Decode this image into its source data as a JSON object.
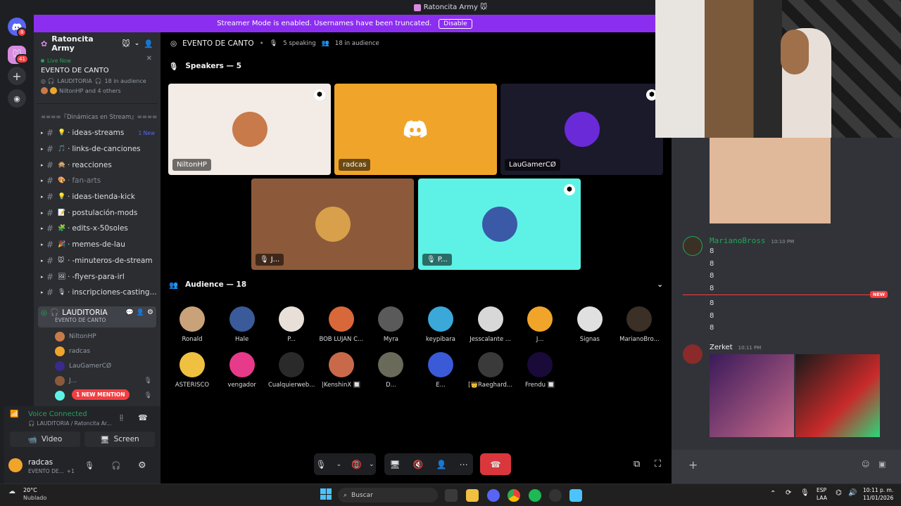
{
  "window": {
    "title": "Ratoncita Army"
  },
  "banner": {
    "text": "Streamer Mode is enabled. Usernames have been truncated.",
    "button": "Disable"
  },
  "rail": {
    "badge_top": "8",
    "badge_server": "41"
  },
  "server": {
    "name": "Ratoncita Army"
  },
  "live": {
    "status": "Live Now",
    "event": "EVENTO DE CANTO",
    "channel": "LAUDITORIA",
    "audience": "18 in audience",
    "others": "NiltonHP and 4 others"
  },
  "category": "====『Dinámicas en Stream』====",
  "channels": [
    {
      "name": "ideas-streams",
      "emoji": "💡",
      "badge": "1 New"
    },
    {
      "name": "links-de-canciones",
      "emoji": "🎵"
    },
    {
      "name": "reacciones",
      "emoji": "🙊"
    },
    {
      "name": "fan-arts",
      "emoji": "🎨"
    },
    {
      "name": "ideas-tienda-kick",
      "emoji": "💡"
    },
    {
      "name": "postulación-mods",
      "emoji": "📝"
    },
    {
      "name": "edits-x-50soles",
      "emoji": "🧩"
    },
    {
      "name": "memes-de-lau",
      "emoji": "🎉"
    },
    {
      "name": "-minuteros-de-stream",
      "emoji": "🐭"
    },
    {
      "name": "-flyers-para-irl",
      "emoji": "🖼"
    },
    {
      "name": "inscripciones-casting...",
      "emoji": "🎙"
    }
  ],
  "voice_channel": {
    "name": "LAUDITORIA",
    "sub": "EVENTO DE CANTO",
    "users": [
      "NiltonHP",
      "radcas",
      "LauGamerCØ",
      "J...",
      ""
    ]
  },
  "mention_pill": "1 NEW MENTION",
  "voice_panel": {
    "status": "Voice Connected",
    "location": "LAUDITORIA / Ratoncita Ar...",
    "video": "Video",
    "screen": "Screen"
  },
  "user": {
    "name": "radcas",
    "status": "EVENTO DE...",
    "extra": "+1"
  },
  "stage": {
    "title": "EVENTO DE CANTO",
    "speaking": "5 speaking",
    "audience": "18 in audience",
    "speakers_header": "Speakers — 5",
    "audience_header": "Audience — 18"
  },
  "speakers": [
    {
      "name": "NiltonHP",
      "bg": "#f2ebe6"
    },
    {
      "name": "radcas",
      "bg": "#f0a52a"
    },
    {
      "name": "LauGamerCØ",
      "bg": "#1b1a2a"
    },
    {
      "name": "J...",
      "bg": "#8c5a3a"
    },
    {
      "name": "P...",
      "bg": "#5ef2e6"
    }
  ],
  "audience": [
    {
      "name": "Ronald",
      "color": "#c9a27a"
    },
    {
      "name": "Hale",
      "color": "#3a5a9a"
    },
    {
      "name": "P...",
      "color": "#e8e0d8"
    },
    {
      "name": "BOB LUJAN C...",
      "color": "#d8683a"
    },
    {
      "name": "Myra",
      "color": "#5a5a5a"
    },
    {
      "name": "keypibara",
      "color": "#3aa8d8"
    },
    {
      "name": "Jesscalante ...",
      "color": "#d8d8d8"
    },
    {
      "name": "J...",
      "color": "#f0a52a"
    },
    {
      "name": "Signas",
      "color": "#e0e0e0"
    },
    {
      "name": "MarianoBro...",
      "color": "#3a3026"
    },
    {
      "name": "ASTERISCO",
      "color": "#f0c040"
    },
    {
      "name": "vengador",
      "color": "#e83a8a"
    },
    {
      "name": "Cualquierweb...",
      "color": "#2a2a2a"
    },
    {
      "name": "|KenshinX 🔲",
      "color": "#c86a4a"
    },
    {
      "name": "D...",
      "color": "#6a6a5a"
    },
    {
      "name": "E...",
      "color": "#3a5ad8"
    },
    {
      "name": "[👑Raeghard...",
      "color": "#3a3a3a"
    },
    {
      "name": "Frendu 🔲",
      "color": "#1a0a3a"
    }
  ],
  "chat": {
    "messages": [
      {
        "author": "MarianoBross",
        "time": "10:10 PM",
        "lines": [
          "8",
          "8",
          "8",
          "8"
        ]
      },
      {
        "lines": [
          "8",
          "8",
          "8"
        ]
      },
      {
        "author": "Zerket",
        "time": "10:11 PM"
      }
    ],
    "new_label": "NEW"
  },
  "taskbar": {
    "weather_temp": "20°C",
    "weather_desc": "Nublado",
    "search": "Buscar",
    "lang1": "ESP",
    "lang2": "LAA",
    "time": "10:11 p. m.",
    "date": "11/01/2026"
  }
}
